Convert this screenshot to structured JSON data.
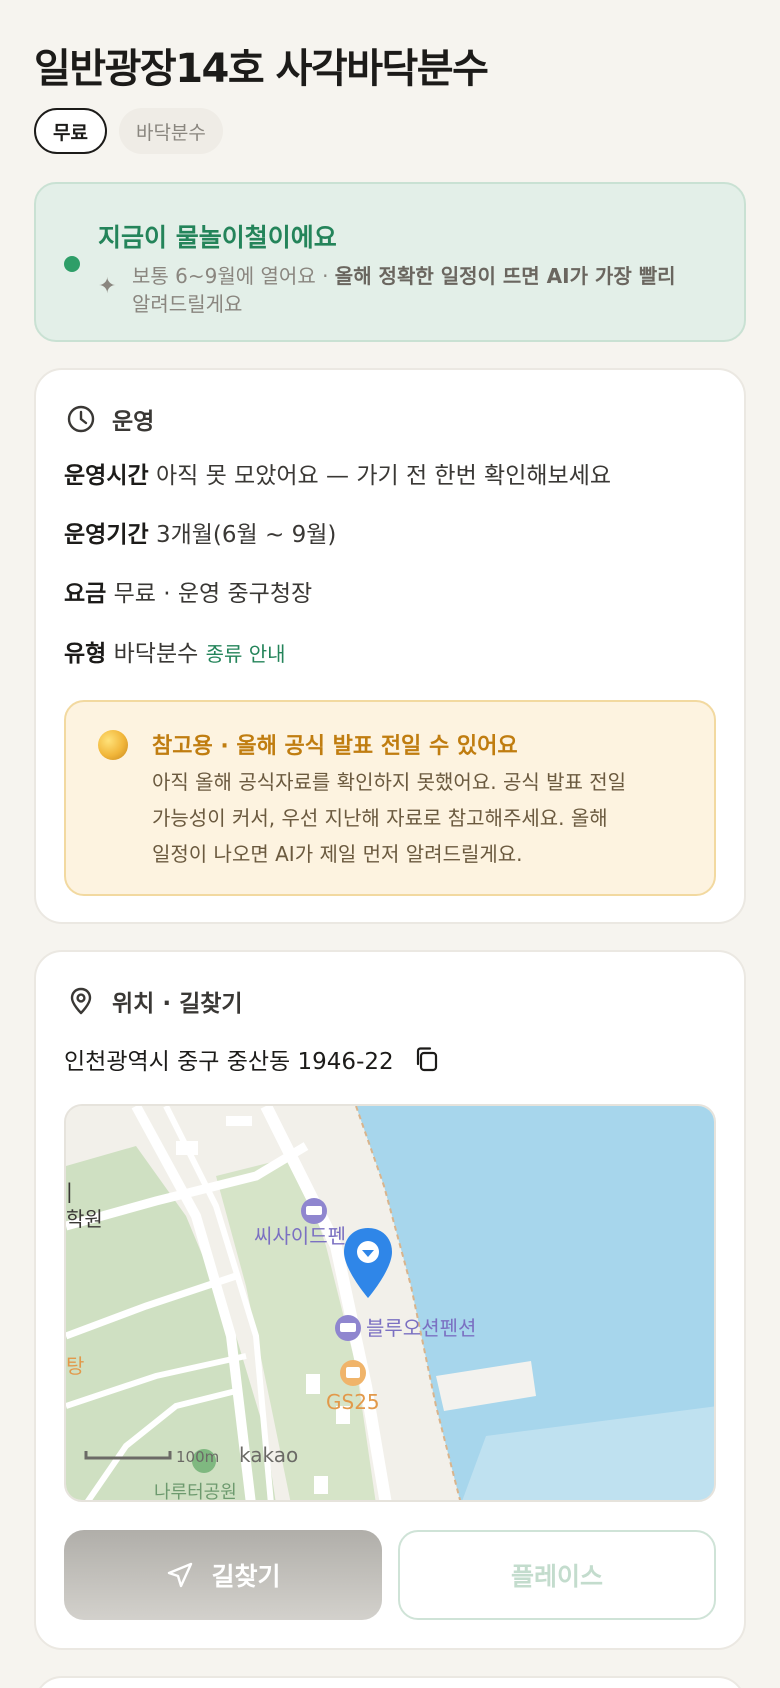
{
  "page": {
    "title": "일반광장14호 사각바닥분수",
    "chips": [
      "무료",
      "바닥분수"
    ]
  },
  "season_banner": {
    "headline": "지금이 물놀이철이에요",
    "note_plain": "보통 6~9월에 열어요 · ",
    "note_bold": "올해 정확한 일정이 뜨면 AI가 가장 빨리",
    "note_tail": "알려드릴게요",
    "accent_color": "#2e9e68"
  },
  "operation": {
    "heading": "운영",
    "rows": [
      {
        "label": "운영시간",
        "value": "아직 못 모았어요 — 가기 전 한번 확인해보세요"
      },
      {
        "label": "운영기간",
        "value": "3개월(6월 ~ 9월)"
      },
      {
        "label": "요금",
        "value": "무료 · 운영 중구청장"
      },
      {
        "label": "유형",
        "value": "바닥분수",
        "link": "종류 안내"
      }
    ],
    "notice": {
      "title": "참고용 · 올해 공식 발표 전일 수 있어요",
      "lines": [
        "아직 올해 공식자료를 확인하지 못했어요. 공식 발표 전일",
        "가능성이 커서, 우선 지난해 자료로 참고해주세요. 올해",
        "일정이 나오면 AI가 제일 먼저 알려드릴게요."
      ]
    }
  },
  "location": {
    "heading": "위치 · 길찾기",
    "address": "인천광역시 중구 중산동 1946-22",
    "map": {
      "labels": {
        "academy": "학원",
        "bar": "|",
        "pension1": "씨사이드펜",
        "pension2": "블루오션펜션",
        "store": "GS25",
        "left_cut": "탕",
        "park": "나루터공원",
        "scale": "100m",
        "brand": "kakao"
      }
    },
    "buttons": {
      "route": "길찾기",
      "place": "플레이스"
    }
  },
  "colors": {
    "background": "#f6f4ef",
    "green": "#24845a",
    "notice_title": "#c07d10",
    "sea": "#a7d6ec",
    "pin": "#2f86e8"
  }
}
